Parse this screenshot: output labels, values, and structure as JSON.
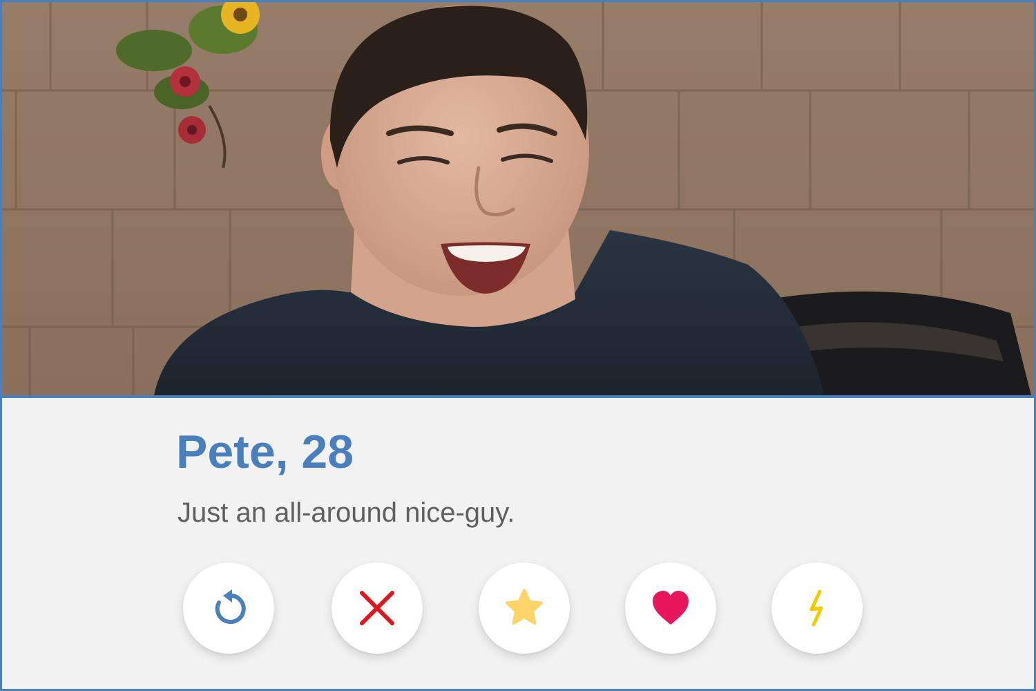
{
  "profile": {
    "name_age": "Pete, 28",
    "bio": "Just an all-around nice-guy."
  },
  "photo": {
    "subject": "smiling young man in a dark t-shirt in front of a shingled wall with flowers"
  },
  "actions": [
    {
      "id": "rewind",
      "icon": "rewind-icon",
      "color": "#4a7fbd"
    },
    {
      "id": "nope",
      "icon": "close-icon",
      "color": "#e0161d"
    },
    {
      "id": "super_like",
      "icon": "star-icon",
      "color": "#fdd36a"
    },
    {
      "id": "like",
      "icon": "heart-icon",
      "color": "#e8175d"
    },
    {
      "id": "boost",
      "icon": "lightning-icon",
      "color": "#f5c800"
    }
  ],
  "colors": {
    "accent": "#4a7fbd",
    "bio_text": "#5f5f5f",
    "panel_bg": "#f2f2f2"
  }
}
